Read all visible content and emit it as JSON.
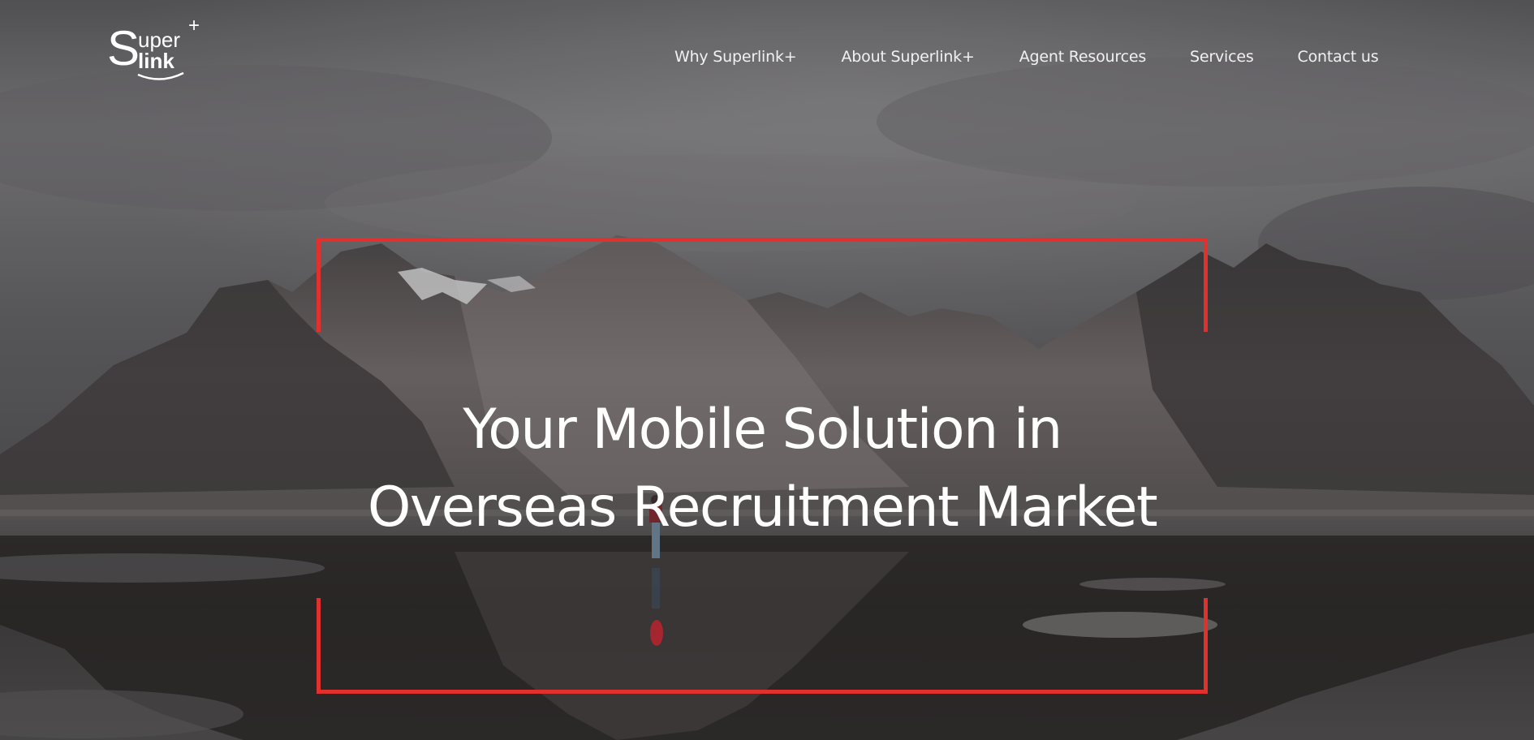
{
  "brand": {
    "logo_big": "S",
    "logo_top": "uper",
    "logo_bottom": "link",
    "logo_plus": "+"
  },
  "nav": {
    "items": [
      {
        "label": "Why Superlink+"
      },
      {
        "label": "About Superlink+"
      },
      {
        "label": "Agent Resources"
      },
      {
        "label": "Services"
      },
      {
        "label": "Contact us"
      }
    ]
  },
  "hero": {
    "title_line1": "Your Mobile Solution in",
    "title_line2": "Overseas Recruitment Market",
    "frame_color": "#e0312e",
    "background": "misty mountain range reflected in still water"
  },
  "colors": {
    "text": "#ffffff",
    "accent": "#e0312e"
  }
}
